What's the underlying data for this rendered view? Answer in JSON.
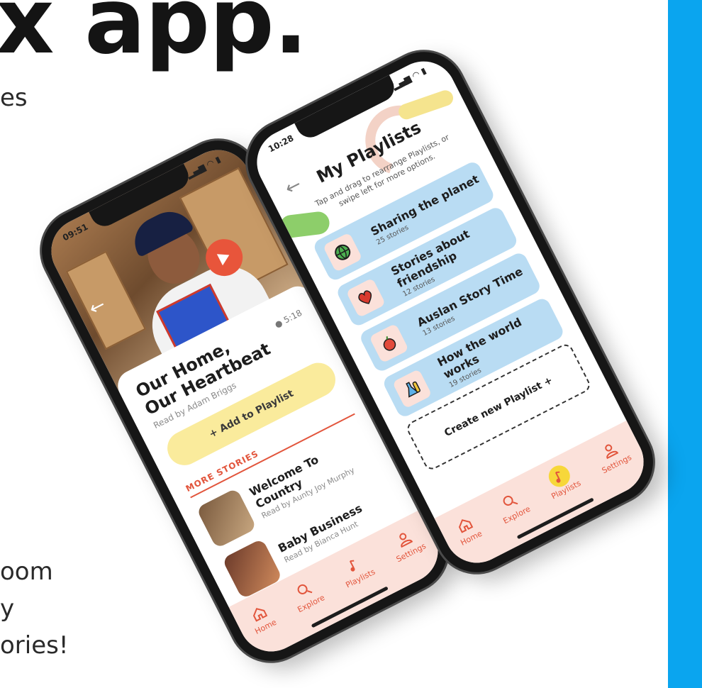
{
  "background": {
    "heading_fragment": "x app.",
    "text_fragments": [
      "es",
      "oom",
      "y",
      "ories!"
    ]
  },
  "colors": {
    "accent": "#e2553c",
    "panel_blue": "#0aa5ef",
    "playlist_card": "#b9dcf3",
    "tabbar_bg": "#fbe1da",
    "add_button": "#faeb9c"
  },
  "phone_left": {
    "status_time": "09:51",
    "status_icons": "▂▄▆ ◠ ▮",
    "video_duration": "5:18",
    "story_title": "Our Home, Our Heartbeat",
    "story_reader": "Read by Adam Briggs",
    "add_to_playlist": "+ Add to Playlist",
    "more_stories_label": "MORE STORIES",
    "stories": [
      {
        "title": "Welcome To Country",
        "reader": "Read by Aunty Joy Murphy"
      },
      {
        "title": "Baby Business",
        "reader": "Read by Bianca Hunt"
      }
    ],
    "tabs": [
      {
        "label": "Home",
        "icon": "home-icon"
      },
      {
        "label": "Explore",
        "icon": "search-icon"
      },
      {
        "label": "Playlists",
        "icon": "music-note-icon"
      },
      {
        "label": "Settings",
        "icon": "user-icon"
      }
    ]
  },
  "phone_right": {
    "status_time": "10:28",
    "status_icons": "▂▄▆ ◠ ▮",
    "title": "My Playlists",
    "subtitle": "Tap and drag to rearrange Playlists, or swipe left for more options.",
    "playlists": [
      {
        "name": "Sharing the planet",
        "count": "25 stories",
        "icon": "globe-icon"
      },
      {
        "name": "Stories about friendship",
        "count": "12 stories",
        "icon": "heart-icon"
      },
      {
        "name": "Auslan Story Time",
        "count": "13 stories",
        "icon": "apple-icon"
      },
      {
        "name": "How the world works",
        "count": "19 stories",
        "icon": "flask-icon"
      }
    ],
    "create_label": "Create new Playlist +",
    "tabs": [
      {
        "label": "Home",
        "icon": "home-icon"
      },
      {
        "label": "Explore",
        "icon": "search-icon"
      },
      {
        "label": "Playlists",
        "icon": "music-note-icon",
        "active": true
      },
      {
        "label": "Settings",
        "icon": "user-icon"
      }
    ]
  }
}
